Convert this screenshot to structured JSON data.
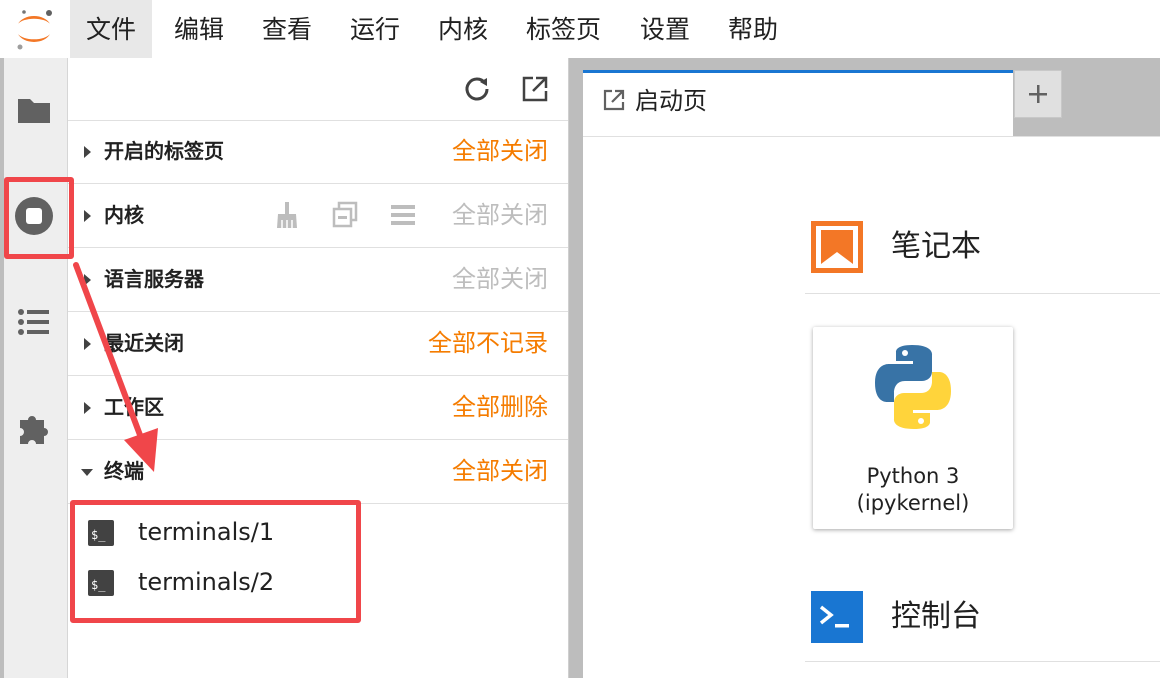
{
  "menubar": {
    "items": [
      "文件",
      "编辑",
      "查看",
      "运行",
      "内核",
      "标签页",
      "设置",
      "帮助"
    ]
  },
  "panel": {
    "sections": [
      {
        "title": "开启的标签页",
        "action": "全部关闭",
        "action_enabled": true
      },
      {
        "title": "内核",
        "action": "全部关闭",
        "action_enabled": false
      },
      {
        "title": "语言服务器",
        "action": "全部关闭",
        "action_enabled": false
      },
      {
        "title": "最近关闭",
        "action": "全部不记录",
        "action_enabled": true
      },
      {
        "title": "工作区",
        "action": "全部删除",
        "action_enabled": true
      },
      {
        "title": "终端",
        "action": "全部关闭",
        "action_enabled": true,
        "expanded": true
      }
    ],
    "terminals": [
      "terminals/1",
      "terminals/2"
    ]
  },
  "main": {
    "tab_label": "启动页",
    "notebook_heading": "笔记本",
    "kernel_card": {
      "line1": "Python 3",
      "line2": "(ipykernel)"
    },
    "console_heading": "控制台"
  },
  "colors": {
    "accent_orange": "#f57c00",
    "disabled": "#bdbdbd",
    "tab_active": "#1976d2",
    "annotation_red": "#f0464a",
    "console_blue": "#1976d2"
  },
  "icons": {
    "logo": "jupyter-logo",
    "activity": [
      "folder-icon",
      "running-icon",
      "list-icon",
      "extension-icon"
    ],
    "toolbar": [
      "refresh-icon",
      "open-new-icon"
    ],
    "kernel_tools": [
      "broom-icon",
      "copy-icon",
      "menu-icon"
    ],
    "terminal": "terminal-icon",
    "launcher_tab": "launch-icon"
  }
}
